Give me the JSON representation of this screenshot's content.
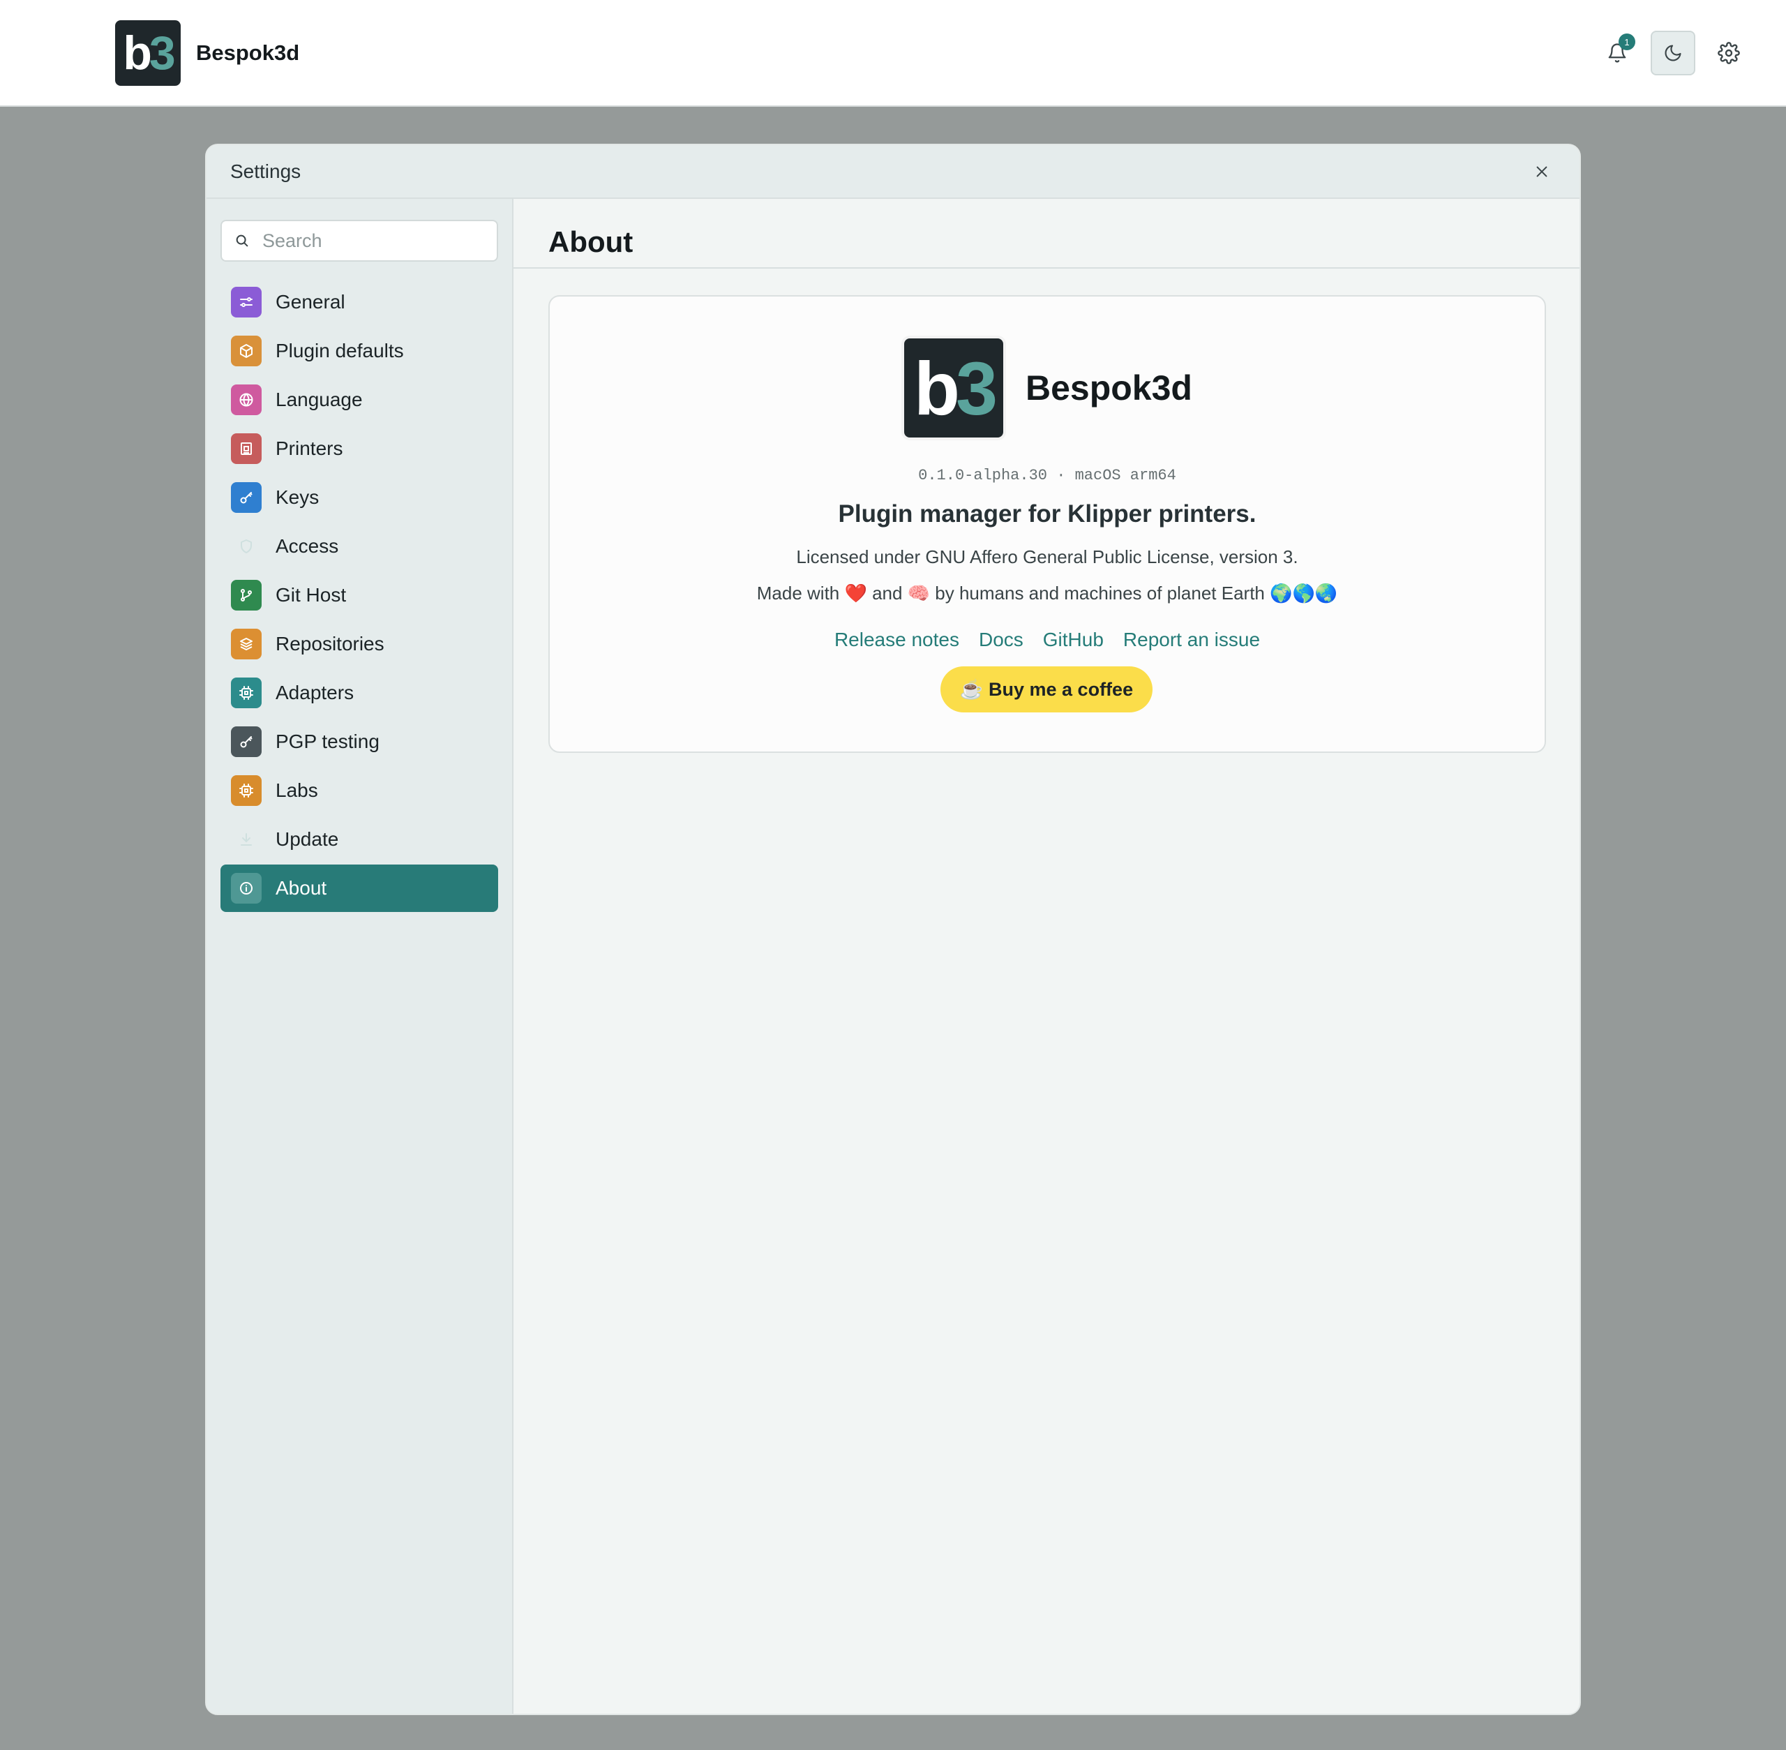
{
  "app": {
    "name": "Bespok3d",
    "logo_b": "b",
    "logo_n": "3"
  },
  "topbar": {
    "notification_count": "1",
    "icons": [
      "bell-icon",
      "moon-icon",
      "gear-icon"
    ]
  },
  "modal": {
    "title": "Settings"
  },
  "search": {
    "placeholder": "Search"
  },
  "sidebar": {
    "items": [
      {
        "label": "General",
        "icon": "sliders-icon",
        "color": "#8b5cd6"
      },
      {
        "label": "Plugin defaults",
        "icon": "box-icon",
        "color": "#d9913a"
      },
      {
        "label": "Language",
        "icon": "globe-icon",
        "color": "#cf5a9f"
      },
      {
        "label": "Printers",
        "icon": "printer-icon",
        "color": "#c65c5c"
      },
      {
        "label": "Keys",
        "icon": "key-icon",
        "color": "#2f7fd0"
      },
      {
        "label": "Access",
        "icon": "shield-icon",
        "color": "transparent"
      },
      {
        "label": "Git Host",
        "icon": "git-branch-icon",
        "color": "#2f8a4f"
      },
      {
        "label": "Repositories",
        "icon": "layers-icon",
        "color": "#dc8f32"
      },
      {
        "label": "Adapters",
        "icon": "chip-icon",
        "color": "#2c8c8c"
      },
      {
        "label": "PGP testing",
        "icon": "key-icon",
        "color": "#4b565b"
      },
      {
        "label": "Labs",
        "icon": "chip-icon",
        "color": "#d88c2c"
      },
      {
        "label": "Update",
        "icon": "download-icon",
        "color": "transparent"
      },
      {
        "label": "About",
        "icon": "info-icon",
        "color": "#4f9894"
      }
    ],
    "selected": "About"
  },
  "about": {
    "title": "About",
    "app_name": "Bespok3d",
    "version": "0.1.0-alpha.30 · macOS arm64",
    "tagline": "Plugin manager for Klipper printers.",
    "license": "Licensed under GNU Affero General Public License, version 3.",
    "made_with": "Made with ❤️ and 🧠 by humans and machines of planet Earth 🌍🌎🌏",
    "links": [
      "Release notes",
      "Docs",
      "GitHub",
      "Report an issue"
    ],
    "coffee_button": "☕ Buy me a coffee"
  },
  "colors": {
    "accent": "#287b78",
    "coffee": "#fbdd4a"
  }
}
